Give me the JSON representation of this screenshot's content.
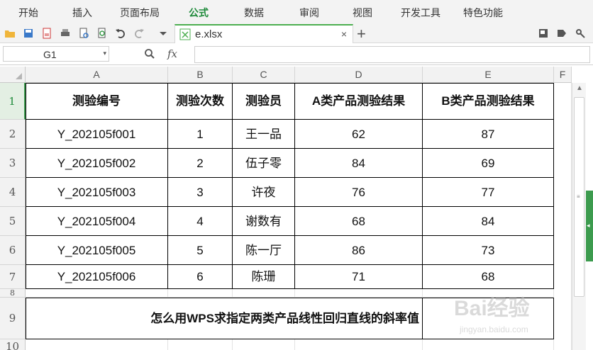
{
  "menu": {
    "tabs": [
      {
        "label": "开始"
      },
      {
        "label": "插入"
      },
      {
        "label": "页面布局"
      },
      {
        "label": "公式",
        "active": true
      },
      {
        "label": "数据"
      },
      {
        "label": "审阅"
      },
      {
        "label": "视图"
      },
      {
        "label": "开发工具"
      },
      {
        "label": "特色功能"
      }
    ]
  },
  "file_tab": {
    "name": "e.xlsx",
    "close_icon": "×",
    "add_icon": "+"
  },
  "formula_bar": {
    "cell_ref": "G1",
    "fx_label": "fx",
    "value": ""
  },
  "columns": [
    "A",
    "B",
    "C",
    "D",
    "E",
    "F"
  ],
  "rows": [
    "1",
    "2",
    "3",
    "4",
    "5",
    "6",
    "7",
    "8",
    "9",
    "10"
  ],
  "table": {
    "headers": [
      "测验编号",
      "测验次数",
      "测验员",
      "A类产品测验结果",
      "B类产品测验结果"
    ],
    "records": [
      [
        "Y_202105f001",
        "1",
        "王一品",
        "62",
        "87"
      ],
      [
        "Y_202105f002",
        "2",
        "伍子零",
        "84",
        "69"
      ],
      [
        "Y_202105f003",
        "3",
        "许夜",
        "76",
        "77"
      ],
      [
        "Y_202105f004",
        "4",
        "谢数有",
        "68",
        "84"
      ],
      [
        "Y_202105f005",
        "5",
        "陈一厅",
        "86",
        "73"
      ],
      [
        "Y_202105f006",
        "6",
        "陈珊",
        "71",
        "68"
      ]
    ],
    "merged_title": "怎么用WPS求指定两类产品线性回归直线的斜率值"
  },
  "watermark": {
    "line1": "Bai经验",
    "line2": "jingyan.baidu.com"
  },
  "colors": {
    "accent": "#1e8a3a",
    "active_tab_border": "#4caf50"
  }
}
